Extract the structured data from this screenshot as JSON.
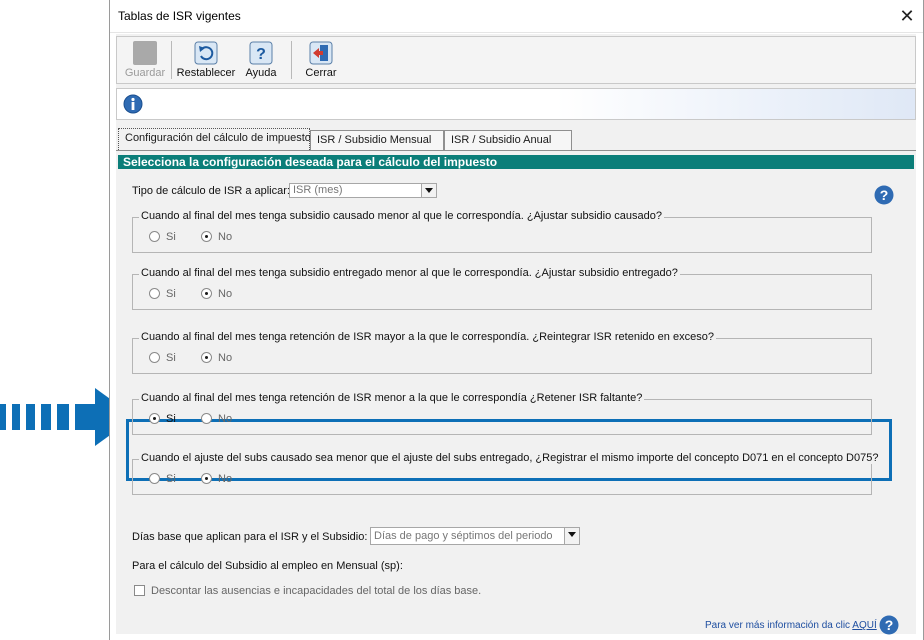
{
  "window": {
    "title": "Tablas de ISR vigentes",
    "close_glyph": "✕"
  },
  "toolbar": {
    "guardar": "Guardar",
    "restablecer": "Restablecer",
    "ayuda": "Ayuda",
    "cerrar": "Cerrar"
  },
  "tabs": [
    {
      "label": "Configuración del cálculo de impuesto"
    },
    {
      "label": "ISR / Subsidio Mensual"
    },
    {
      "label": "ISR / Subsidio Anual"
    }
  ],
  "section": {
    "header": "Selecciona la configuración deseada para el cálculo del impuesto"
  },
  "tipo_calculo": {
    "label": "Tipo de cálculo de ISR a aplicar:",
    "value": "ISR (mes)"
  },
  "groups": [
    {
      "question": "Cuando al final del mes tenga subsidio causado menor al que le correspondía. ¿Ajustar subsidio causado?",
      "si": "Si",
      "no": "No",
      "selected": "No"
    },
    {
      "question": "Cuando al final del mes tenga subsidio entregado menor al que le correspondía. ¿Ajustar subsidio entregado?",
      "si": "Si",
      "no": "No",
      "selected": "No"
    },
    {
      "question": "Cuando al final del mes tenga retención de ISR mayor a la que le correspondía. ¿Reintegrar ISR retenido en exceso?",
      "si": "Si",
      "no": "No",
      "selected": "No"
    },
    {
      "question": "Cuando al final del mes tenga retención de ISR menor a la que le correspondía ¿Retener ISR faltante?",
      "si": "Si",
      "no": "No",
      "selected": "Si"
    },
    {
      "question": "Cuando el ajuste del subs causado sea menor que el ajuste del subs entregado, ¿Registrar el mismo importe del concepto D071 en el concepto D075?",
      "si": "Si",
      "no": "No",
      "selected": "No"
    }
  ],
  "dias_base": {
    "label": "Días base que aplican para el  ISR y el Subsidio:",
    "value": "Días de pago y séptimos del periodo"
  },
  "subsidio": {
    "label": "Para el cálculo del Subsidio al empleo en Mensual (sp):",
    "checkbox_label": "Descontar las ausencias e incapacidades del total de los días base."
  },
  "footer": {
    "info_text": "Para ver más información da clic",
    "link": "AQUÍ"
  },
  "colors": {
    "section_header": "#0b7e79",
    "highlight": "#0d6fb6",
    "arrow": "#0d6fb6"
  },
  "icons": [
    "save-icon",
    "restore-icon",
    "help-icon",
    "exit-icon",
    "info-icon",
    "close-icon"
  ]
}
